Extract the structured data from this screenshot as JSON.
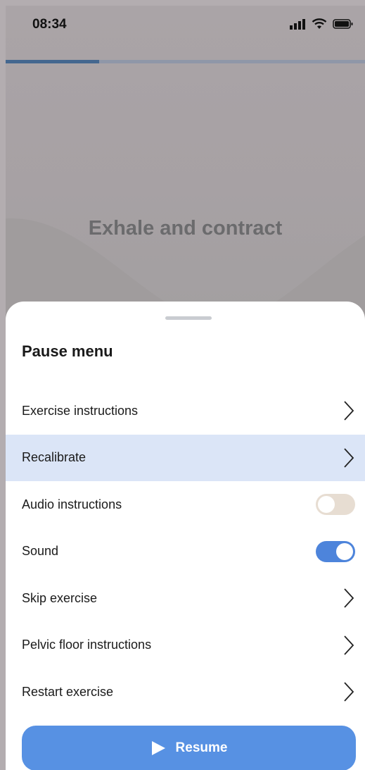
{
  "status_bar": {
    "time": "08:34"
  },
  "progress": {
    "fraction": 0.26
  },
  "prompt": "Exhale and contract",
  "sheet": {
    "title": "Pause menu",
    "items": [
      {
        "label": "Exercise instructions",
        "control": "chevron"
      },
      {
        "label": "Recalibrate",
        "control": "chevron"
      },
      {
        "label": "Audio instructions",
        "control": "toggle",
        "on": false
      },
      {
        "label": "Sound",
        "control": "toggle",
        "on": true
      },
      {
        "label": "Skip exercise",
        "control": "chevron"
      },
      {
        "label": "Pelvic floor instructions",
        "control": "chevron"
      },
      {
        "label": "Restart exercise",
        "control": "chevron"
      }
    ],
    "resume_label": "Resume"
  },
  "colors": {
    "accent": "#5791e3",
    "highlight": "#dbe5f7",
    "toggle_on": "#4d84db",
    "toggle_off": "#e7ddd2"
  }
}
